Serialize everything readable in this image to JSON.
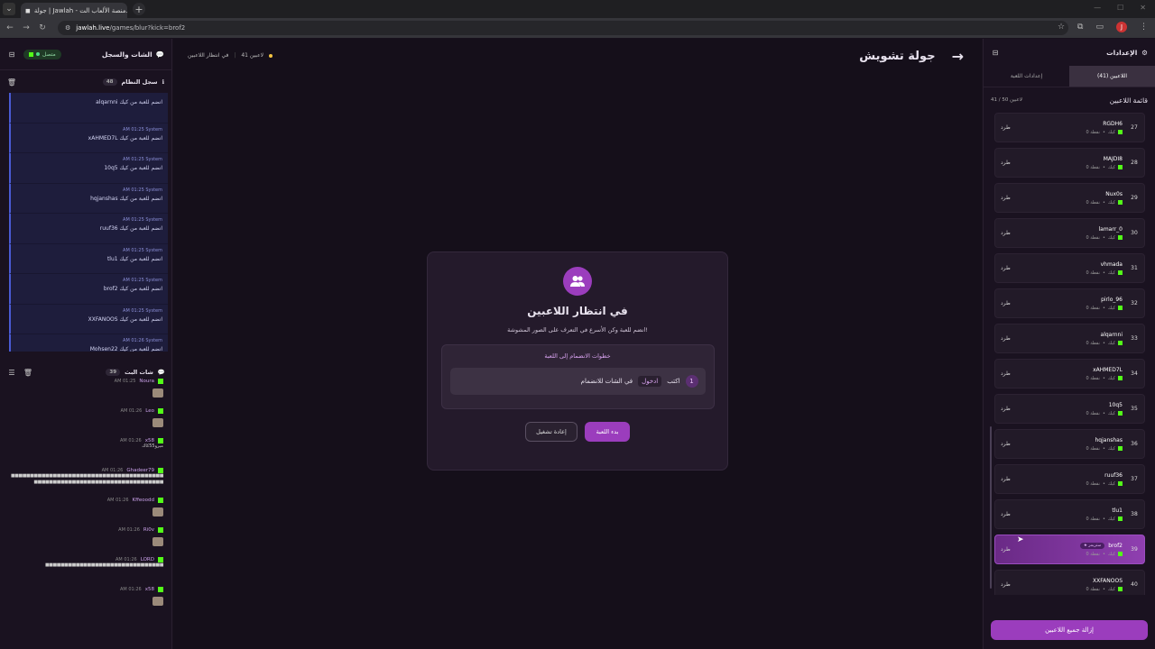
{
  "browser": {
    "tab_title": "جولة | Jawlah - منصة الألعاب الت...",
    "url_host": "jawlah.live",
    "url_path": "/games/blur?kick=brof2",
    "profile_initial": "J"
  },
  "left": {
    "title": "الشات والسجل",
    "online_label": "متصل",
    "system_log_label": "سجل النظام",
    "system_log_count": "48",
    "log_items": [
      {
        "meta": "",
        "msg": "alqarnni انضم للعبة من كيك"
      },
      {
        "meta": "AM 01:25 System",
        "msg": "xAHMED7L انضم للعبة من كيك"
      },
      {
        "meta": "AM 01:25 System",
        "msg": "10q5 انضم للعبة من كيك"
      },
      {
        "meta": "AM 01:25 System",
        "msg": "hqjanshas انضم للعبة من كيك"
      },
      {
        "meta": "AM 01:25 System",
        "msg": "ruuf36 انضم للعبة من كيك"
      },
      {
        "meta": "AM 01:25 System",
        "msg": "tlu1 انضم للعبة من كيك"
      },
      {
        "meta": "AM 01:25 System",
        "msg": "brof2 انضم للعبة من كيك"
      },
      {
        "meta": "AM 01:25 System",
        "msg": "XXFANOOS انضم للعبة من كيك"
      },
      {
        "meta": "AM 01:26 System",
        "msg": "Mohsen22 انضم للعبة من كيك"
      }
    ],
    "live_chat_label": "شات البث",
    "live_chat_count": "39",
    "chat_items": [
      {
        "time": "AM 01:25",
        "name": "Noura",
        "text": ""
      },
      {
        "time": "AM 01:26",
        "name": "Leo",
        "text": ""
      },
      {
        "time": "AM 01:26",
        "name": "x58",
        "text": "ميرو55كاك"
      },
      {
        "time": "AM 01:26",
        "name": "Ghadeer79",
        "text": "■■■■■■■■■■■■■■■■■■■■■■■■■■■■■■■■■■■■■■■■■■■■■■■■■■■■■■■■■■■■■■■■■■■■■■■■■■"
      },
      {
        "time": "AM 01:26",
        "name": "Kffeoodd",
        "text": ""
      },
      {
        "time": "AM 01:26",
        "name": "Ri0v",
        "text": ""
      },
      {
        "time": "AM 01:26",
        "name": "LORD",
        "text": "■■■■■■■■■■■■■■■■■■■■■■■■■■■■■■■"
      },
      {
        "time": "AM 01:26",
        "name": "x58",
        "text": ""
      }
    ]
  },
  "center": {
    "players_count_label": "41 لاعبين",
    "status_label": "في انتظار اللاعبين",
    "game_title": "جولة تشويش",
    "card_title": "في انتظار اللاعبين",
    "card_sub": "انضم للعبة وكن الأسرع في التعرف على الصور المشوشة!",
    "steps_title": "خطوات الانضمام إلى اللعبة",
    "step_num": "1",
    "step_pre": "اكتب",
    "step_code": "ادخول",
    "step_post": "في الشات للانضمام",
    "restart_label": "إعادة تشغيل",
    "start_label": "بدء اللعبة"
  },
  "right": {
    "title": "الإعدادات",
    "tab_players": "اللاعبين (41)",
    "tab_settings": "إعدادات اللعبة",
    "list_title": "قائمة اللاعبين",
    "list_count": "41 / 50 لاعبين",
    "kick_label": "طرد",
    "points_label": "0 نقطة",
    "source_label": "كيك",
    "streamer_badge": "★ ستريمر",
    "players": [
      {
        "num": "27",
        "name": "RGDH6",
        "highlight": false
      },
      {
        "num": "28",
        "name": "MAJDI8",
        "highlight": false
      },
      {
        "num": "29",
        "name": "Nux0s",
        "highlight": false
      },
      {
        "num": "30",
        "name": "lamarr_0",
        "highlight": false
      },
      {
        "num": "31",
        "name": "vhmada",
        "highlight": false
      },
      {
        "num": "32",
        "name": "pirlo_96",
        "highlight": false
      },
      {
        "num": "33",
        "name": "alqarnni",
        "highlight": false
      },
      {
        "num": "34",
        "name": "xAHMED7L",
        "highlight": false
      },
      {
        "num": "35",
        "name": "10q5",
        "highlight": false
      },
      {
        "num": "36",
        "name": "hqjanshas",
        "highlight": false
      },
      {
        "num": "37",
        "name": "ruuf36",
        "highlight": false
      },
      {
        "num": "38",
        "name": "tlu1",
        "highlight": false
      },
      {
        "num": "39",
        "name": "brof2",
        "highlight": true
      },
      {
        "num": "40",
        "name": "XXFANOOS",
        "highlight": false
      }
    ],
    "remove_all_label": "إزالة جميع اللاعبين"
  },
  "colors": {
    "accent": "#9b3dbd",
    "kick": "#53fc18",
    "system": "#4a5bd4"
  }
}
